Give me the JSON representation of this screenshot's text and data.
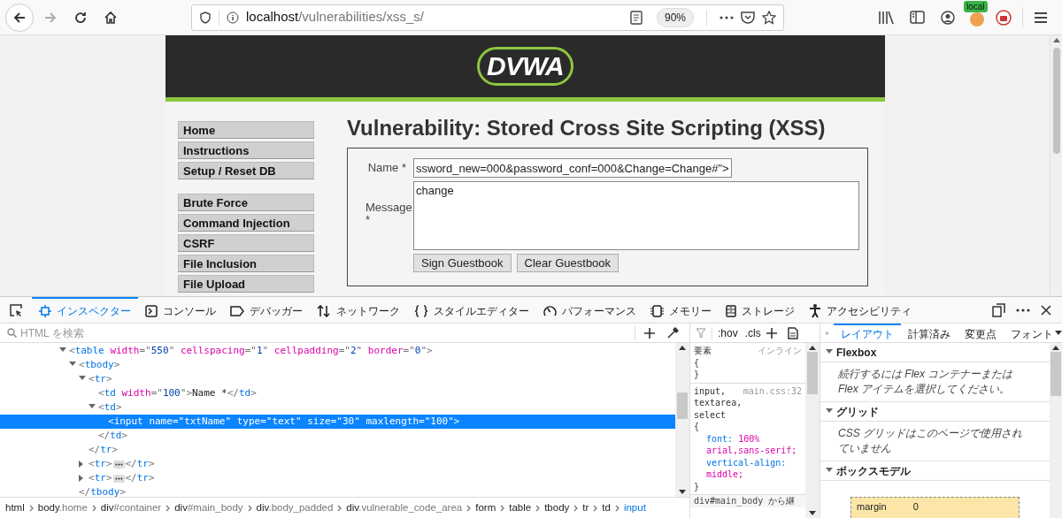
{
  "browser": {
    "url_host": "localhost",
    "url_path": "/vulnerabilities/xss_s/",
    "zoom": "90%",
    "badge": "local"
  },
  "page": {
    "logo": "DVWA",
    "menu_groups": [
      [
        "Home",
        "Instructions",
        "Setup / Reset DB"
      ],
      [
        "Brute Force",
        "Command Injection",
        "CSRF",
        "File Inclusion",
        "File Upload"
      ]
    ],
    "title": "Vulnerability: Stored Cross Site Scripting (XSS)",
    "form": {
      "name_label": "Name *",
      "name_value": "ssword_new=000&password_conf=000&Change=Change#\">",
      "message_label": "Message *",
      "message_value": "change",
      "buttons": [
        "Sign Guestbook",
        "Clear Guestbook"
      ]
    }
  },
  "devtools": {
    "tabs": [
      {
        "label": "インスペクター",
        "selected": true
      },
      {
        "label": "コンソール",
        "selected": false
      },
      {
        "label": "デバッガー",
        "selected": false
      },
      {
        "label": "ネットワーク",
        "selected": false
      },
      {
        "label": "スタイルエディター",
        "selected": false
      },
      {
        "label": "パフォーマンス",
        "selected": false
      },
      {
        "label": "メモリー",
        "selected": false
      },
      {
        "label": "ストレージ",
        "selected": false
      },
      {
        "label": "アクセシビリティ",
        "selected": false
      }
    ],
    "search": {
      "placeholder": "HTML を検索"
    },
    "dom": [
      {
        "open": "<table width=\"550\" cellspacing=\"1\" cellpadding=\"2\" border=\"0\">",
        "expanded": true,
        "selected": false,
        "children": [
          {
            "open": "<tbody>",
            "close": "</tbody>",
            "expanded": true,
            "selected": false,
            "children": [
              {
                "open": "<tr>",
                "close": "</tr>",
                "expanded": true,
                "selected": false,
                "children": [
                  {
                    "open": "<td width=\"100\">",
                    "text": "Name *",
                    "close": "</td>",
                    "selected": false
                  },
                  {
                    "open": "<td>",
                    "close": "</td>",
                    "expanded": true,
                    "selected": false,
                    "children": [
                      {
                        "open": "<input name=\"txtName\" type=\"text\" size=\"30\" maxlength=\"100\">",
                        "selected": true
                      }
                    ]
                  }
                ]
              },
              {
                "open": "<tr>",
                "close": "</tr>",
                "expanded": false,
                "selected": false
              },
              {
                "open": "<tr>",
                "close": "</tr>",
                "expanded": false,
                "selected": false
              }
            ]
          }
        ]
      }
    ],
    "breadcrumb": [
      {
        "element": "html",
        "selected": false
      },
      {
        "element": "body",
        "qualifier": ".home",
        "selected": false
      },
      {
        "element": "div",
        "qualifier": "#container",
        "selected": false
      },
      {
        "element": "div",
        "qualifier": "#main_body",
        "selected": false
      },
      {
        "element": "div",
        "qualifier": ".body_padded",
        "selected": false
      },
      {
        "element": "div",
        "qualifier": ".vulnerable_code_area",
        "selected": false
      },
      {
        "element": "form",
        "selected": false
      },
      {
        "element": "table",
        "selected": false
      },
      {
        "element": "tbody",
        "selected": false
      },
      {
        "element": "tr",
        "selected": false
      },
      {
        "element": "td",
        "selected": false
      },
      {
        "element": "input",
        "selected": true
      }
    ],
    "rules_toolbar": [
      ":hov",
      ".cls"
    ],
    "rules": [
      {
        "selector": "要素",
        "source": "インライン",
        "open": "{",
        "close": "}"
      },
      {
        "selector": "input, textarea, select",
        "source": "main.css:32",
        "open": "{",
        "declarations": [
          "font: 100% arial,sans-serif;",
          "vertical-align: middle;"
        ],
        "close": "}"
      }
    ],
    "rules_footer": "div#main_body から継",
    "layout_tabs": [
      {
        "label": "レイアウト",
        "selected": true
      },
      {
        "label": "計算済み",
        "selected": false
      },
      {
        "label": "変更点",
        "selected": false
      },
      {
        "label": "フォント",
        "selected": false
      }
    ],
    "layout_sections": [
      {
        "title": "Flexbox",
        "expanded": true,
        "text": "続行するには Flex コンテナーまたは Flex アイテムを選択してください。"
      },
      {
        "title": "グリッド",
        "expanded": true,
        "text": "CSS グリッドはこのページで使用されていません"
      },
      {
        "title": "ボックスモデル",
        "expanded": true,
        "box_label": "margin",
        "box_value": "0"
      }
    ]
  }
}
